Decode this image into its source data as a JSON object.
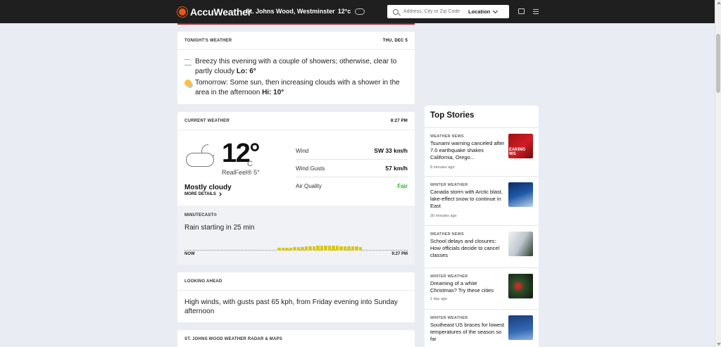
{
  "header": {
    "brand": "AccuWeather",
    "location": "St. Johns Wood, Westminster",
    "temp": "12°c",
    "search_placeholder": "Address, City or Zip Code",
    "location_button": "Location"
  },
  "tonight": {
    "title": "TONIGHT'S WEATHER",
    "date": "THU, DEC 5",
    "rows": [
      {
        "text": "Breezy this evening with a couple of showers; otherwise, clear to partly cloudy",
        "label": "Lo: 6°"
      },
      {
        "text": "Tomorrow: Some sun, then increasing clouds with a shower in the area in the afternoon",
        "label": "Hi: 10°"
      }
    ]
  },
  "current": {
    "title": "CURRENT WEATHER",
    "time": "8:27 PM",
    "temp": "12°",
    "unit": "C",
    "realfeel": "RealFeel® 5°",
    "condition": "Mostly cloudy",
    "more": "MORE DETAILS",
    "stats": [
      {
        "label": "Wind",
        "value": "SW 33 km/h"
      },
      {
        "label": "Wind Gusts",
        "value": "57 km/h"
      },
      {
        "label": "Air Quality",
        "value": "Fair"
      }
    ]
  },
  "minutecast": {
    "label": "MINUTECAST®",
    "text": "Rain starting in 25 min",
    "start": "NOW",
    "end": "9:27 PM",
    "bars": [
      0.45,
      0.5,
      0.55,
      0.55,
      0.6,
      0.6,
      0.65,
      0.7,
      0.75,
      0.8,
      0.85,
      0.9,
      0.9,
      0.9,
      0.85,
      0.85,
      0.8,
      0.8,
      0.75,
      0.7,
      0.7,
      0.65
    ],
    "colors": {
      "bar": "#d8c91e"
    }
  },
  "ahead": {
    "title": "LOOKING AHEAD",
    "text": "High winds, with gusts past 65 kph, from Friday evening into Sunday afternoon"
  },
  "radar": {
    "title": "ST. JOHNS WOOD WEATHER RADAR & MAPS"
  },
  "stories": {
    "title": "Top Stories",
    "items": [
      {
        "category": "WEATHER NEWS",
        "headline": "Tsunami warning canceled after 7.0 earthquake shakes California, Orego...",
        "time": "8 minutes ago",
        "img_text": "EAKING WS"
      },
      {
        "category": "WINTER WEATHER",
        "headline": "Canada storm with Arctic blast, lake-effect snow to continue in East",
        "time": "30 minutes ago"
      },
      {
        "category": "WEATHER NEWS",
        "headline": "School delays and closures: How officials decide to cancel classes",
        "time": ""
      },
      {
        "category": "WINTER WEATHER",
        "headline": "Dreaming of a white Christmas? Try these cities",
        "time": "1 day ago"
      },
      {
        "category": "WINTER WEATHER",
        "headline": "Southeast US braces for lowest temperatures of the season so far",
        "time": ""
      }
    ]
  }
}
